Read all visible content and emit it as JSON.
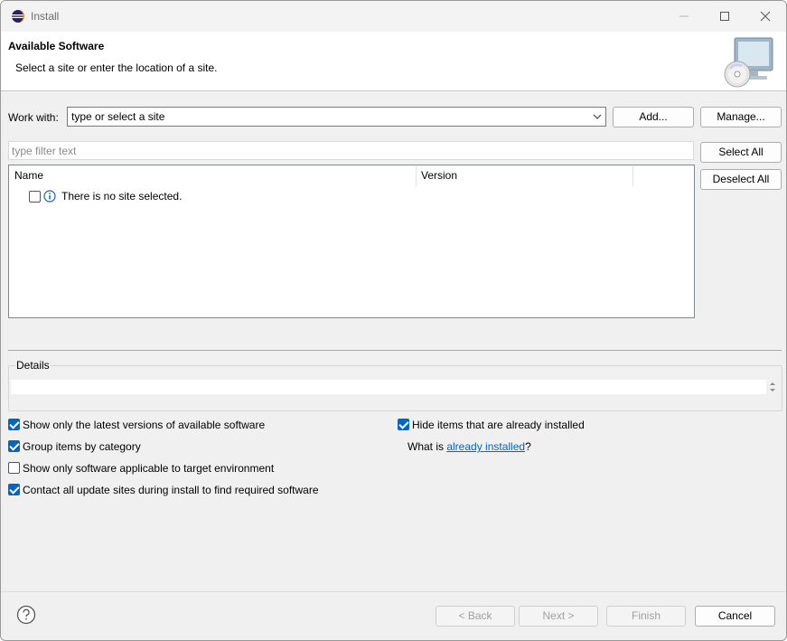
{
  "window": {
    "title": "Install",
    "controls": {
      "minimize": "minimize-icon",
      "maximize": "maximize-icon",
      "close": "close-icon"
    }
  },
  "header": {
    "title": "Available Software",
    "description": "Select a site or enter the location of a site."
  },
  "work_with": {
    "label": "Work with:",
    "value": "type or select a site",
    "add_label": "Add...",
    "manage_label": "Manage..."
  },
  "filter": {
    "placeholder": "type filter text"
  },
  "selection": {
    "select_all": "Select All",
    "deselect_all": "Deselect All"
  },
  "table": {
    "columns": [
      "Name",
      "Version"
    ],
    "rows": [
      {
        "name": "There is no site selected.",
        "checked": false,
        "icon": "info-icon"
      }
    ]
  },
  "details": {
    "label": "Details"
  },
  "options": {
    "latest_versions": {
      "label": "Show only the latest versions of available software",
      "checked": true
    },
    "group_by_category": {
      "label": "Group items by category",
      "checked": true
    },
    "target_env": {
      "label": "Show only software applicable to target environment",
      "checked": false
    },
    "contact_sites": {
      "label": "Contact all update sites during install to find required software",
      "checked": true
    },
    "hide_installed": {
      "label": "Hide items that are already installed",
      "checked": true
    },
    "what_is_prefix": "What is ",
    "what_is_link": "already installed",
    "what_is_suffix": "?"
  },
  "footer": {
    "back": "< Back",
    "next": "Next >",
    "finish": "Finish",
    "cancel": "Cancel"
  },
  "colors": {
    "accent": "#0067c0",
    "link": "#0563c1"
  }
}
